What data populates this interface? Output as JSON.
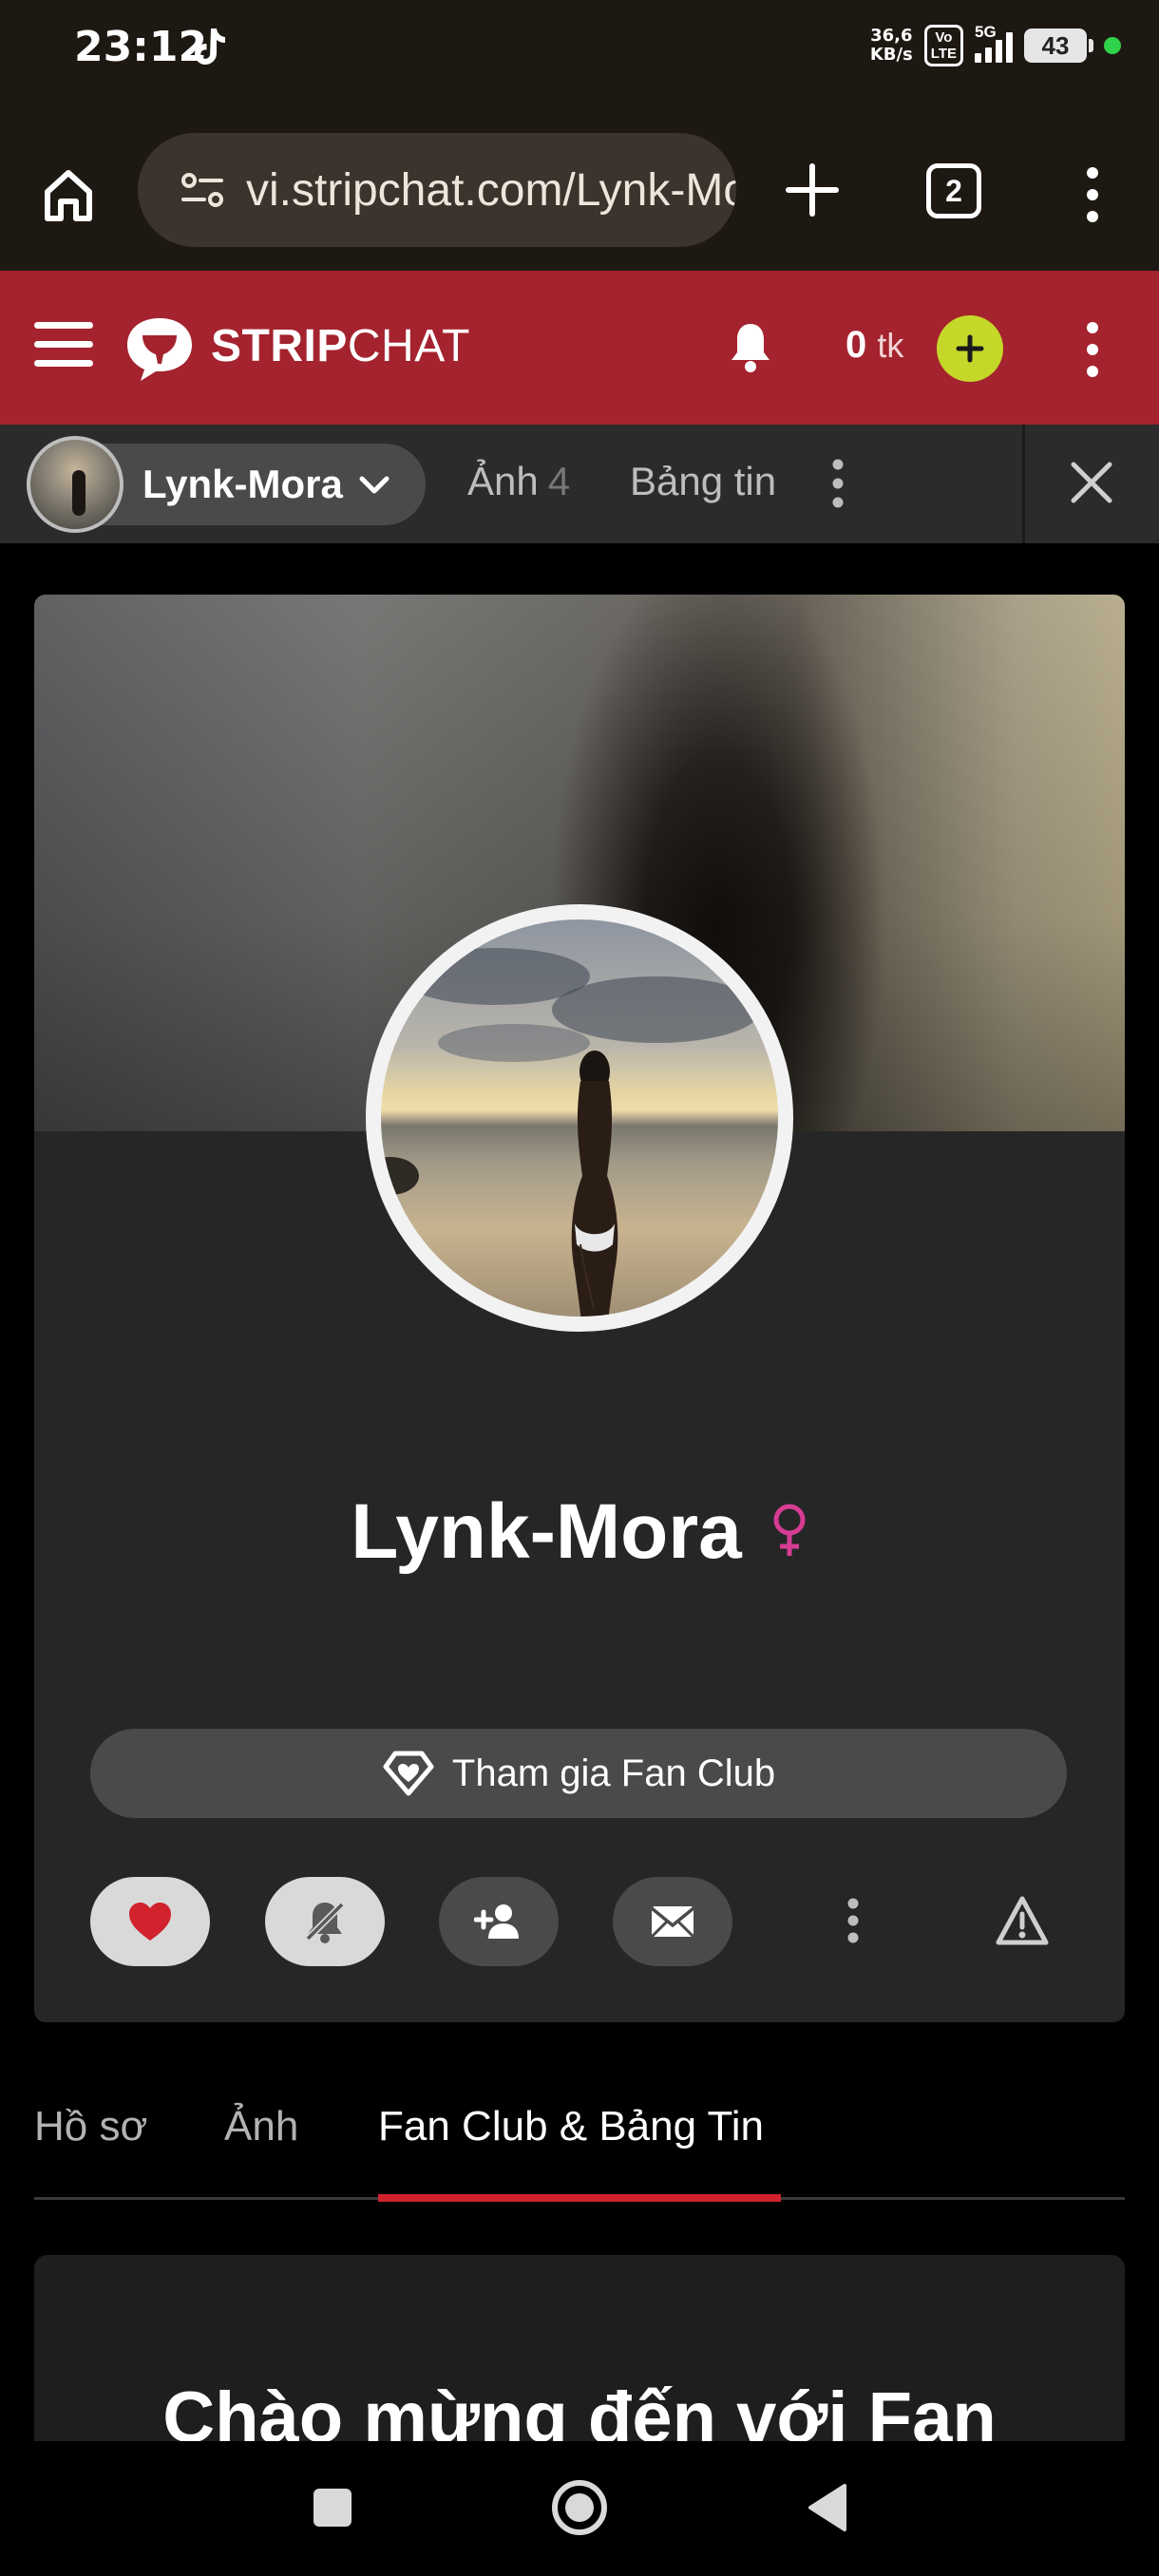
{
  "status_bar": {
    "time": "23:12",
    "net_speed_value": "36,6",
    "net_speed_unit": "KB/s",
    "volte_top": "Vo",
    "volte_bottom": "LTE",
    "network": "5G",
    "battery": "43"
  },
  "browser": {
    "url": "vi.stripchat.com/Lynk-Mora",
    "tab_count": "2"
  },
  "header": {
    "logo_bold": "STRIP",
    "logo_light": "CHAT",
    "token_amount": "0",
    "token_unit": "tk",
    "colors": {
      "header_bg": "#a4232e",
      "buy_button": "#c5d82a"
    }
  },
  "sub_nav": {
    "model_name": "Lynk-Mora",
    "photos_label": "Ảnh",
    "photos_count": "4",
    "feed_label": "Bảng tin"
  },
  "profile": {
    "name": "Lynk-Mora",
    "gender_icon": "female-icon",
    "fan_club_button": "Tham gia Fan Club",
    "actions": [
      "favorite-heart-icon",
      "mute-notifications-icon",
      "subscribe-add-user-icon",
      "message-envelope-icon",
      "more-vertical-icon",
      "report-warning-icon"
    ]
  },
  "tabs": [
    {
      "label": "Hồ sơ",
      "active": false
    },
    {
      "label": "Ảnh",
      "active": false
    },
    {
      "label": "Fan Club & Bảng Tin",
      "active": true
    }
  ],
  "welcome": {
    "title": "Chào mừng đến với Fan"
  },
  "colors": {
    "accent_red": "#d1222e",
    "page_bg": "#000000",
    "card_bg": "#262626",
    "female_pink": "#d63c93"
  }
}
